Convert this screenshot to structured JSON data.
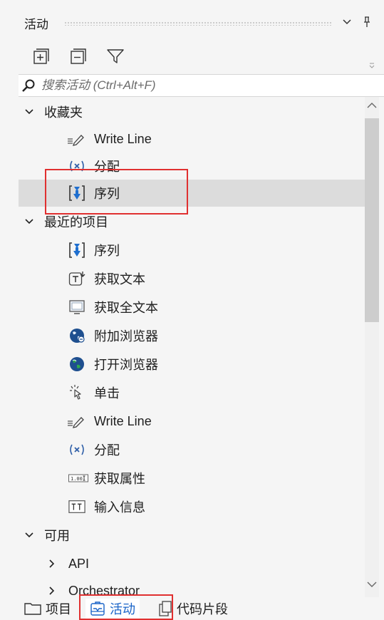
{
  "panel": {
    "title": "活动",
    "dropdown_icon": "chevron-down-icon",
    "pin_icon": "pin-icon"
  },
  "toolbar": {
    "expand_all_icon": "expand-all-icon",
    "collapse_all_icon": "collapse-all-icon",
    "filter_icon": "filter-icon"
  },
  "search": {
    "placeholder": "搜索活动 (Ctrl+Alt+F)"
  },
  "tree": {
    "favorites": {
      "label": "收藏夹",
      "items": [
        {
          "label": "Write Line",
          "icon": "write-line-icon"
        },
        {
          "label": "分配",
          "icon": "assign-icon"
        },
        {
          "label": "序列",
          "icon": "sequence-icon"
        }
      ]
    },
    "recent": {
      "label": "最近的项目",
      "items": [
        {
          "label": "序列",
          "icon": "sequence-icon"
        },
        {
          "label": "获取文本",
          "icon": "get-text-icon"
        },
        {
          "label": "获取全文本",
          "icon": "get-full-text-icon"
        },
        {
          "label": "附加浏览器",
          "icon": "attach-browser-icon"
        },
        {
          "label": "打开浏览器",
          "icon": "open-browser-icon"
        },
        {
          "label": "单击",
          "icon": "click-icon"
        },
        {
          "label": "Write Line",
          "icon": "write-line-icon"
        },
        {
          "label": "分配",
          "icon": "assign-icon"
        },
        {
          "label": "获取属性",
          "icon": "get-attribute-icon"
        },
        {
          "label": "输入信息",
          "icon": "type-into-icon"
        }
      ]
    },
    "available": {
      "label": "可用",
      "items": [
        {
          "label": "API"
        },
        {
          "label": "Orchestrator"
        }
      ]
    }
  },
  "bottom_tabs": [
    {
      "label": "项目",
      "icon": "folder-icon",
      "active": false
    },
    {
      "label": "活动",
      "icon": "activities-icon",
      "active": true
    },
    {
      "label": "代码片段",
      "icon": "snippets-icon",
      "active": false
    }
  ],
  "highlight_color": "#e03030",
  "accent_color": "#1a64c8"
}
